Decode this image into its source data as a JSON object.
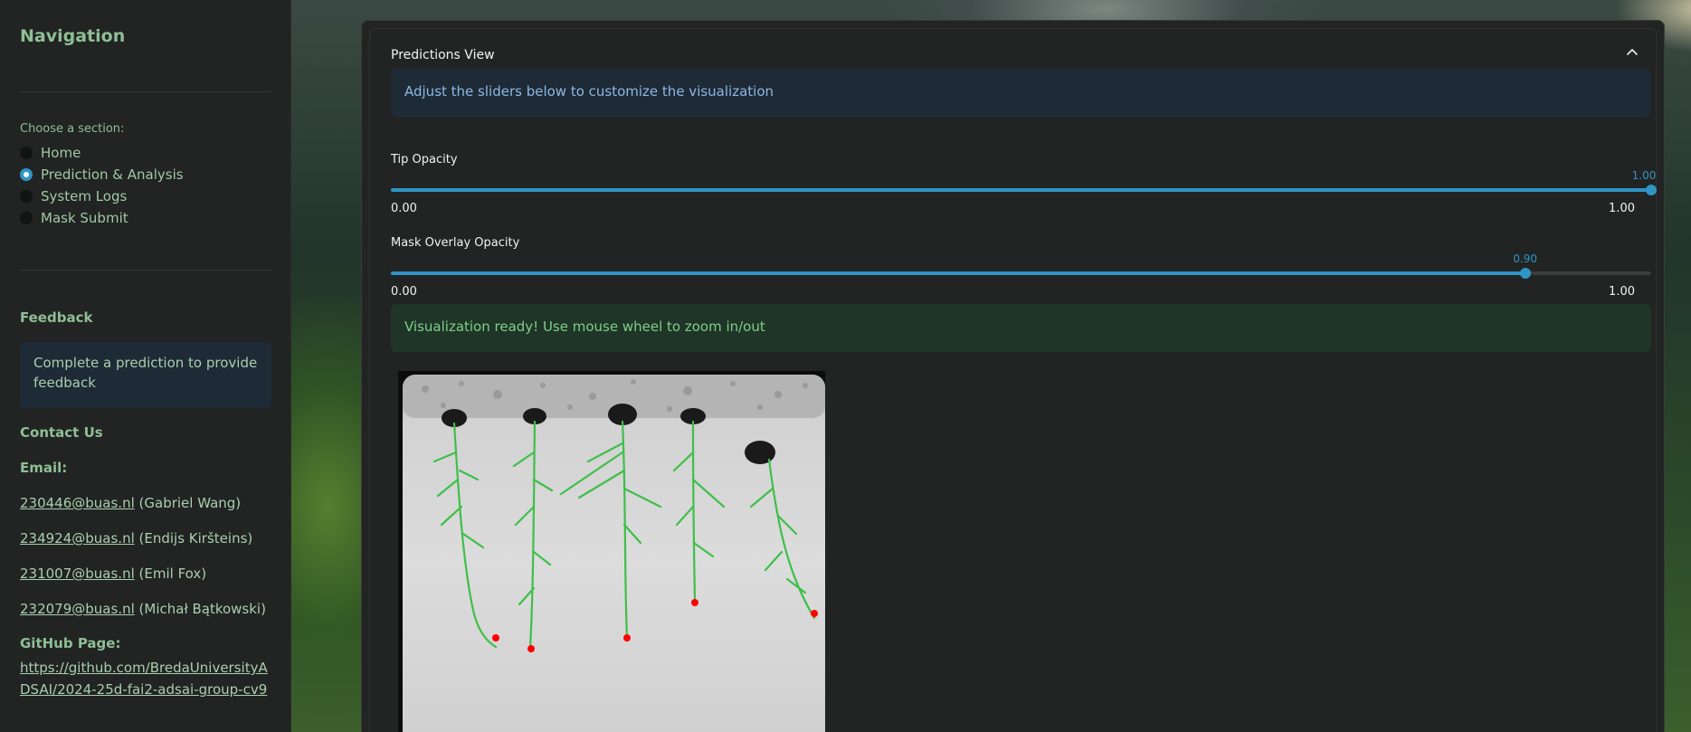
{
  "sidebar": {
    "title": "Navigation",
    "choose_label": "Choose a section:",
    "sections": [
      {
        "label": "Home",
        "selected": false
      },
      {
        "label": "Prediction & Analysis",
        "selected": true
      },
      {
        "label": "System Logs",
        "selected": false
      },
      {
        "label": "Mask Submit",
        "selected": false
      }
    ],
    "feedback_heading": "Feedback",
    "feedback_text": "Complete a prediction to provide feedback",
    "contact_heading": "Contact Us",
    "email_heading": "Email:",
    "emails": [
      {
        "address": "230446@buas.nl",
        "name": "(Gabriel Wang)"
      },
      {
        "address": "234924@buas.nl",
        "name": "(Endijs Kiršteins)"
      },
      {
        "address": "231007@buas.nl",
        "name": "(Emil Fox)"
      },
      {
        "address": "232079@buas.nl",
        "name": "(Michał Bątkowski)"
      }
    ],
    "github_heading": "GitHub Page:",
    "github_link": "https://github.com/BredaUniversityADSAI/2024-25d-fai2-adsai-group-cv9"
  },
  "main": {
    "panel_title": "Predictions View",
    "info_text": "Adjust the sliders below to customize the visualization",
    "sliders": [
      {
        "label": "Tip Opacity",
        "value": 1.0,
        "value_text": "1.00",
        "min_text": "0.00",
        "max_text": "1.00"
      },
      {
        "label": "Mask Overlay Opacity",
        "value": 0.9,
        "value_text": "0.90",
        "min_text": "0.00",
        "max_text": "1.00"
      }
    ],
    "success_text": "Visualization ready! Use mouse wheel to zoom in/out"
  },
  "colors": {
    "accent": "#2f95c4",
    "sidebar_text": "#8fbf95",
    "root_mask": "#3fbf4a",
    "tip_marker": "#ff0000"
  }
}
